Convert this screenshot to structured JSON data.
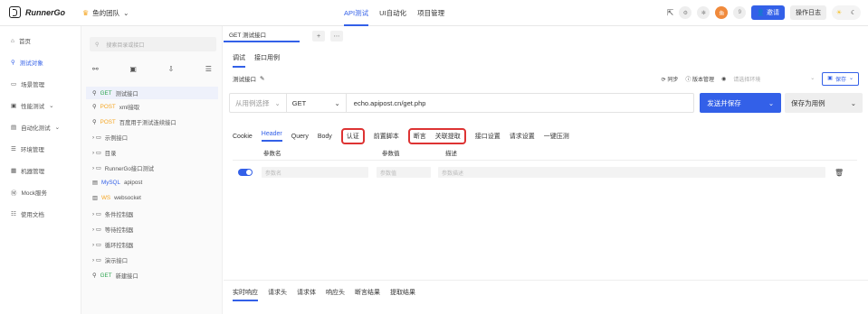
{
  "app": {
    "name": "RunnerGo"
  },
  "team": {
    "name": "鱼的团队"
  },
  "nav_tabs": [
    {
      "label": "API测试"
    },
    {
      "label": "UI自动化"
    },
    {
      "label": "项目管理"
    }
  ],
  "header": {
    "avatar_text": "鱼",
    "user_count": "9",
    "invite_label": "邀请",
    "oplog_label": "操作日志"
  },
  "sidebar": {
    "items": [
      {
        "label": "首页"
      },
      {
        "label": "测试对象"
      },
      {
        "label": "场景管理"
      },
      {
        "label": "性能测试"
      },
      {
        "label": "自动化测试"
      },
      {
        "label": "环境管理"
      },
      {
        "label": "机器管理"
      },
      {
        "label": "Mock服务"
      },
      {
        "label": "使用文档"
      }
    ]
  },
  "tree": {
    "search_placeholder": "搜索目录或接口",
    "rows": [
      {
        "method": "GET",
        "name": "测试接口"
      },
      {
        "method": "POST",
        "name": "xml接取"
      },
      {
        "method": "POST",
        "name": "百度用于测试连续接口"
      },
      {
        "method": "",
        "name": "示例接口"
      },
      {
        "method": "",
        "name": "目录"
      },
      {
        "method": "",
        "name": "RunnerGo接口测试"
      },
      {
        "method": "MySQL",
        "name": "apipost"
      },
      {
        "method": "WS",
        "name": "websocket"
      },
      {
        "method": "",
        "name": "条件控制器"
      },
      {
        "method": "",
        "name": "等待控制器"
      },
      {
        "method": "",
        "name": "循环控制器"
      },
      {
        "method": "",
        "name": "演示接口"
      },
      {
        "method": "GET",
        "name": "新建接口"
      }
    ]
  },
  "editor": {
    "tab_label": "GET 测试接口",
    "sub_tabs": [
      {
        "label": "调试"
      },
      {
        "label": "接口用例"
      }
    ],
    "api_name": "测试接口",
    "sync_label": "同步",
    "version_label": "版本管理",
    "env_placeholder": "请选择环境",
    "save_label": "保存",
    "case_select": "从用例选择",
    "method": "GET",
    "url": "echo.apipost.cn/get.php",
    "send_label": "发送并保存",
    "save_as_label": "保存为用例",
    "param_tabs": {
      "cookie": "Cookie",
      "header": "Header",
      "query": "Query",
      "body": "Body",
      "auth": "认证",
      "pre_script": "前置脚本",
      "assert": "断言",
      "extract": "关联提取",
      "api_settings": "接口设置",
      "request_settings": "请求设置",
      "stress": "一键压测"
    },
    "table": {
      "col_name": "参数名",
      "col_value": "参数值",
      "col_desc": "描述",
      "ph_name": "参数名",
      "ph_value": "参数值",
      "ph_desc": "参数描述"
    },
    "response_tabs": [
      {
        "label": "实时响应"
      },
      {
        "label": "请求头"
      },
      {
        "label": "请求体"
      },
      {
        "label": "响应头"
      },
      {
        "label": "断言结果"
      },
      {
        "label": "提取结果"
      }
    ]
  }
}
